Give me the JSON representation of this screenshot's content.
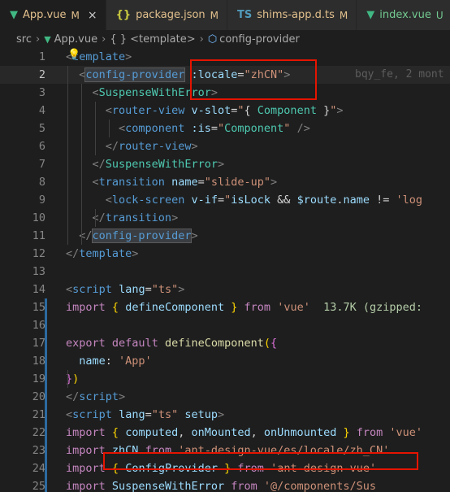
{
  "tabs": [
    {
      "icon": "vue-icon",
      "glyph": "▼",
      "label": "App.vue",
      "modified": "M",
      "active": true,
      "color": "#41b883"
    },
    {
      "icon": "json-icon",
      "glyph": "{}",
      "label": "package.json",
      "modified": "M",
      "active": false,
      "color": "#cbcb41"
    },
    {
      "icon": "ts-icon",
      "glyph": "TS",
      "label": "shims-app.d.ts",
      "modified": "M",
      "active": false,
      "color": "#519aba"
    },
    {
      "icon": "vue-icon",
      "glyph": "▼",
      "label": "index.vue",
      "modified": "U",
      "active": false,
      "color": "#41b883"
    }
  ],
  "breadcrumb": [
    "src",
    "App.vue",
    "{ } <template>",
    "config-provider"
  ],
  "blame": "bqy_fe, 2 mont",
  "lines": [
    {
      "n": "1",
      "tokens": [
        [
          "c-br",
          "<"
        ],
        [
          "c-tag",
          "template"
        ],
        [
          "c-br",
          ">"
        ]
      ]
    },
    {
      "n": "2",
      "tokens": [
        [
          "c-txt",
          "  "
        ],
        [
          "c-br",
          "<"
        ],
        [
          "c-tag word-hl",
          "config-provider"
        ],
        [
          "c-txt",
          " "
        ],
        [
          "c-attr",
          ":locale"
        ],
        [
          "c-txt",
          "="
        ],
        [
          "c-str",
          "\"zhCN\""
        ],
        [
          "c-br",
          ">"
        ]
      ]
    },
    {
      "n": "3",
      "tokens": [
        [
          "c-txt",
          "    "
        ],
        [
          "c-br",
          "<"
        ],
        [
          "c-cmp",
          "SuspenseWithError"
        ],
        [
          "c-br",
          ">"
        ]
      ]
    },
    {
      "n": "4",
      "tokens": [
        [
          "c-txt",
          "      "
        ],
        [
          "c-br",
          "<"
        ],
        [
          "c-tag",
          "router-view"
        ],
        [
          "c-txt",
          " "
        ],
        [
          "c-attr",
          "v-slot"
        ],
        [
          "c-txt",
          "="
        ],
        [
          "c-str",
          "\""
        ],
        [
          "c-txt",
          "{ "
        ],
        [
          "c-cmp",
          "Component"
        ],
        [
          "c-txt",
          " }"
        ],
        [
          "c-str",
          "\""
        ],
        [
          "c-br",
          ">"
        ]
      ]
    },
    {
      "n": "5",
      "tokens": [
        [
          "c-txt",
          "        "
        ],
        [
          "c-br",
          "<"
        ],
        [
          "c-tag",
          "component"
        ],
        [
          "c-txt",
          " "
        ],
        [
          "c-attr",
          ":is"
        ],
        [
          "c-txt",
          "="
        ],
        [
          "c-str",
          "\""
        ],
        [
          "c-cmp",
          "Component"
        ],
        [
          "c-str",
          "\""
        ],
        [
          "c-txt",
          " "
        ],
        [
          "c-br",
          "/>"
        ]
      ]
    },
    {
      "n": "6",
      "tokens": [
        [
          "c-txt",
          "      "
        ],
        [
          "c-br",
          "</"
        ],
        [
          "c-tag",
          "router-view"
        ],
        [
          "c-br",
          ">"
        ]
      ]
    },
    {
      "n": "7",
      "tokens": [
        [
          "c-txt",
          "    "
        ],
        [
          "c-br",
          "</"
        ],
        [
          "c-cmp",
          "SuspenseWithError"
        ],
        [
          "c-br",
          ">"
        ]
      ]
    },
    {
      "n": "8",
      "tokens": [
        [
          "c-txt",
          "    "
        ],
        [
          "c-br",
          "<"
        ],
        [
          "c-tag",
          "transition"
        ],
        [
          "c-txt",
          " "
        ],
        [
          "c-attr",
          "name"
        ],
        [
          "c-txt",
          "="
        ],
        [
          "c-str",
          "\"slide-up\""
        ],
        [
          "c-br",
          ">"
        ]
      ]
    },
    {
      "n": "9",
      "tokens": [
        [
          "c-txt",
          "      "
        ],
        [
          "c-br",
          "<"
        ],
        [
          "c-tag",
          "lock-screen"
        ],
        [
          "c-txt",
          " "
        ],
        [
          "c-attr",
          "v-if"
        ],
        [
          "c-txt",
          "="
        ],
        [
          "c-str",
          "\""
        ],
        [
          "c-var",
          "isLock"
        ],
        [
          "c-txt",
          " && "
        ],
        [
          "c-var",
          "$route"
        ],
        [
          "c-txt",
          "."
        ],
        [
          "c-var",
          "name"
        ],
        [
          "c-txt",
          " != "
        ],
        [
          "c-str",
          "'log"
        ]
      ]
    },
    {
      "n": "10",
      "tokens": [
        [
          "c-txt",
          "    "
        ],
        [
          "c-br",
          "</"
        ],
        [
          "c-tag",
          "transition"
        ],
        [
          "c-br",
          ">"
        ]
      ]
    },
    {
      "n": "11",
      "tokens": [
        [
          "c-txt",
          "  "
        ],
        [
          "c-br",
          "</"
        ],
        [
          "c-tag word-hl",
          "config-provider"
        ],
        [
          "c-br",
          ">"
        ]
      ]
    },
    {
      "n": "12",
      "tokens": [
        [
          "c-br",
          "</"
        ],
        [
          "c-tag",
          "template"
        ],
        [
          "c-br",
          ">"
        ]
      ]
    },
    {
      "n": "13",
      "tokens": []
    },
    {
      "n": "14",
      "tokens": [
        [
          "c-br",
          "<"
        ],
        [
          "c-tag",
          "script"
        ],
        [
          "c-txt",
          " "
        ],
        [
          "c-attr",
          "lang"
        ],
        [
          "c-txt",
          "="
        ],
        [
          "c-str",
          "\"ts\""
        ],
        [
          "c-br",
          ">"
        ]
      ]
    },
    {
      "n": "15",
      "tokens": [
        [
          "c-kw",
          "import"
        ],
        [
          "c-txt",
          " "
        ],
        [
          "c-brace",
          "{"
        ],
        [
          "c-txt",
          " "
        ],
        [
          "c-var",
          "defineComponent"
        ],
        [
          "c-txt",
          " "
        ],
        [
          "c-brace",
          "}"
        ],
        [
          "c-txt",
          " "
        ],
        [
          "c-kw",
          "from"
        ],
        [
          "c-txt",
          " "
        ],
        [
          "c-str",
          "'vue'"
        ],
        [
          "c-txt",
          "  "
        ],
        [
          "c-size",
          "13.7K (gzipped:"
        ]
      ]
    },
    {
      "n": "16",
      "tokens": []
    },
    {
      "n": "17",
      "tokens": [
        [
          "c-kw",
          "export"
        ],
        [
          "c-txt",
          " "
        ],
        [
          "c-kw",
          "default"
        ],
        [
          "c-txt",
          " "
        ],
        [
          "c-fn",
          "defineComponent"
        ],
        [
          "c-brace",
          "("
        ],
        [
          "c-brace2",
          "{"
        ]
      ]
    },
    {
      "n": "18",
      "tokens": [
        [
          "c-txt",
          "  "
        ],
        [
          "c-var",
          "name"
        ],
        [
          "c-txt",
          ": "
        ],
        [
          "c-str",
          "'App'"
        ]
      ]
    },
    {
      "n": "19",
      "tokens": [
        [
          "c-brace2",
          "}"
        ],
        [
          "c-brace",
          ")"
        ]
      ]
    },
    {
      "n": "20",
      "tokens": [
        [
          "c-br",
          "</"
        ],
        [
          "c-tag",
          "script"
        ],
        [
          "c-br",
          ">"
        ]
      ]
    },
    {
      "n": "21",
      "tokens": [
        [
          "c-br",
          "<"
        ],
        [
          "c-tag",
          "script"
        ],
        [
          "c-txt",
          " "
        ],
        [
          "c-attr",
          "lang"
        ],
        [
          "c-txt",
          "="
        ],
        [
          "c-str",
          "\"ts\""
        ],
        [
          "c-txt",
          " "
        ],
        [
          "c-attr",
          "setup"
        ],
        [
          "c-br",
          ">"
        ]
      ]
    },
    {
      "n": "22",
      "tokens": [
        [
          "c-kw",
          "import"
        ],
        [
          "c-txt",
          " "
        ],
        [
          "c-brace",
          "{"
        ],
        [
          "c-txt",
          " "
        ],
        [
          "c-var",
          "computed"
        ],
        [
          "c-txt",
          ", "
        ],
        [
          "c-var",
          "onMounted"
        ],
        [
          "c-txt",
          ", "
        ],
        [
          "c-var",
          "onUnmounted"
        ],
        [
          "c-txt",
          " "
        ],
        [
          "c-brace",
          "}"
        ],
        [
          "c-txt",
          " "
        ],
        [
          "c-kw",
          "from"
        ],
        [
          "c-txt",
          " "
        ],
        [
          "c-str",
          "'vue'"
        ]
      ]
    },
    {
      "n": "23",
      "tokens": [
        [
          "c-kw",
          "import"
        ],
        [
          "c-txt",
          " "
        ],
        [
          "c-var",
          "zhCN"
        ],
        [
          "c-txt",
          " "
        ],
        [
          "c-kw",
          "from"
        ],
        [
          "c-txt",
          " "
        ],
        [
          "c-str",
          "'ant-design-vue/es/locale/zh_CN'"
        ]
      ]
    },
    {
      "n": "24",
      "tokens": [
        [
          "c-kw",
          "import"
        ],
        [
          "c-txt",
          " "
        ],
        [
          "c-brace",
          "{"
        ],
        [
          "c-txt",
          " "
        ],
        [
          "c-var",
          "ConfigProvider"
        ],
        [
          "c-txt",
          " "
        ],
        [
          "c-brace",
          "}"
        ],
        [
          "c-txt",
          " "
        ],
        [
          "c-kw",
          "from"
        ],
        [
          "c-txt",
          " "
        ],
        [
          "c-str",
          "'ant-design-vue'"
        ]
      ]
    },
    {
      "n": "25",
      "tokens": [
        [
          "c-kw",
          "import"
        ],
        [
          "c-txt",
          " "
        ],
        [
          "c-var",
          "SuspenseWithError"
        ],
        [
          "c-txt",
          " "
        ],
        [
          "c-kw",
          "from"
        ],
        [
          "c-txt",
          " "
        ],
        [
          "c-str",
          "'@/components/Sus"
        ]
      ]
    }
  ]
}
